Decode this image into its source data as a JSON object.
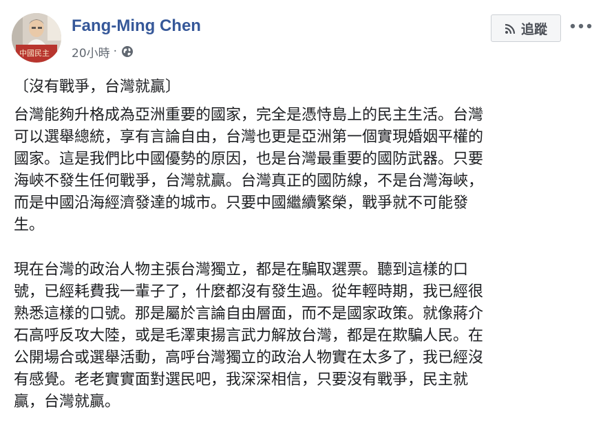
{
  "post": {
    "author": "Fang-Ming Chen",
    "timestamp": "20小時",
    "separator": "·",
    "privacy_icon": "globe-icon",
    "follow_label": "追蹤",
    "follow_icon": "rss-icon",
    "more_icon": "more-options-icon",
    "avatar_caption": "中國民主",
    "title": "〔沒有戰爭，台灣就贏〕",
    "paragraphs": [
      {
        "lines": [
          "台灣能夠升格成為亞洲重要的國家，完全是憑恃島上的民主生活。台灣",
          "可以選舉總統，享有言論自由，台灣也更是亞洲第一個實現婚姻平權的",
          "國家。這是我們比中國優勢的原因，也是台灣最重要的國防武器。只要",
          "海峽不發生任何戰爭，台灣就贏。台灣真正的國防線，不是台灣海峽，",
          "而是中國沿海經濟發達的城市。只要中國繼續繁榮，戰爭就不可能發",
          "生。"
        ]
      },
      {
        "lines": [
          "現在台灣的政治人物主張台灣獨立，都是在騙取選票。聽到這樣的口",
          "號，已經耗費我一輩子了，什麼都沒有發生過。從年輕時期，我已經很",
          "熟悉這樣的口號。那是屬於言論自由層面，而不是國家政策。就像蔣介",
          "石高呼反攻大陸，或是毛澤東揚言武力解放台灣，都是在欺騙人民。在",
          "公開場合或選舉活動，高呼台灣獨立的政治人物實在太多了，我已經沒",
          "有感覺。老老實實面對選民吧，我深深相信，只要沒有戰爭，民主就",
          "贏，台灣就贏。"
        ]
      }
    ]
  },
  "colors": {
    "link": "#365899",
    "text": "#1c1e21",
    "meta": "#606770",
    "button_bg": "#f5f6f7",
    "button_border": "#ccd0d5"
  }
}
